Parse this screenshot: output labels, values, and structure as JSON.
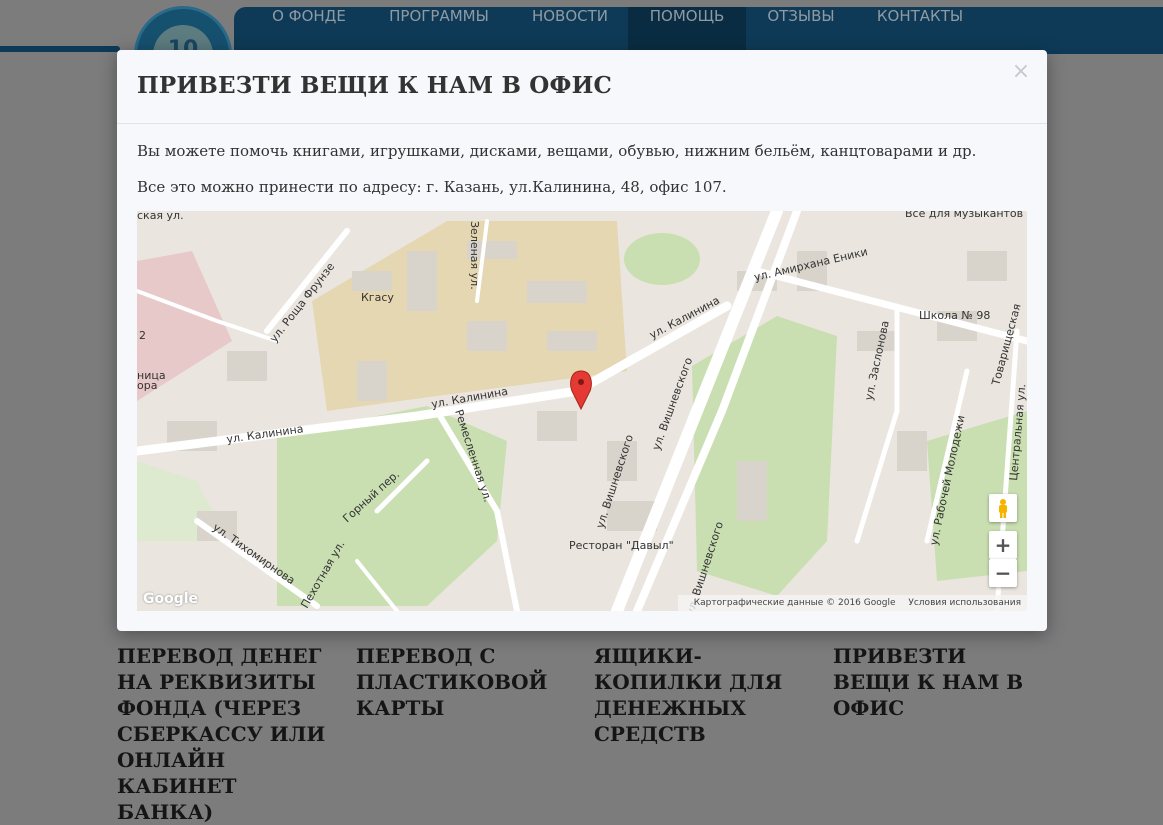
{
  "header": {
    "logo_number": "10",
    "nav": [
      {
        "label": "О ФОНДЕ",
        "active": false
      },
      {
        "label": "ПРОГРАММЫ",
        "active": false
      },
      {
        "label": "НОВОСТИ",
        "active": false
      },
      {
        "label": "ПОМОЩЬ",
        "active": true
      },
      {
        "label": "ОТЗЫВЫ",
        "active": false
      },
      {
        "label": "КОНТАКТЫ",
        "active": false
      }
    ]
  },
  "cards": [
    {
      "title": "ПЕРЕВОД ДЕНЕГ НА РЕКВИЗИТЫ ФОНДА (ЧЕРЕЗ СБЕРКАССУ ИЛИ ОНЛАЙН КАБИНЕТ БАНКА)"
    },
    {
      "title": "ПЕРЕВОД С ПЛАСТИКОВОЙ КАРТЫ"
    },
    {
      "title": "ЯЩИКИ-КОПИЛКИ ДЛЯ ДЕНЕЖНЫХ СРЕДСТВ"
    },
    {
      "title": "ПРИВЕЗТИ ВЕЩИ К НАМ В ОФИС"
    }
  ],
  "modal": {
    "title": "ПРИВЕЗТИ ВЕЩИ К НАМ В ОФИС",
    "close_label": "×",
    "text1": "Вы можете помочь книгами, игрушками, дисками, вещами, обувью, нижним бельём, канцтоварами и др.",
    "text2": "Все это можно принести по адресу: г. Казань, ул.Калинина, 48, офис 107."
  },
  "map": {
    "labels": {
      "kalinina_1": "ул. Калинина",
      "kalinina_2": "ул. Калинина",
      "kalinina_3": "ул. Калинина",
      "roscha": "ул. Роща Фрунзе",
      "amirhana": "ул. Амирхана Еники",
      "vishnevskogo_1": "ул. Вишневского",
      "vishnevskogo_2": "ул. Вишневского",
      "vishnevskogo_3": "ул. Вишневского",
      "remeslennaya": "Ремесленная ул.",
      "gorny": "Горный пер.",
      "tihomirnova": "ул. Тихомирнова",
      "zaslonova": "ул. Заслонова",
      "rabochey": "ул. Рабочей Молодежи",
      "tsentralnaya": "Центральная ул.",
      "tovarisch": "Товарищеская",
      "pehotnaya": "Пехотная ул.",
      "zelenaya": "Зеленая ул.",
      "kgasu": "Кгасу",
      "school": "Школа № 98",
      "restaurant": "Ресторан \"Давыл\"",
      "music": "Все для музыкантов",
      "hosp_1": "2",
      "hosp_2": "ница",
      "hosp_3": "ора",
      "top_left": "ская ул."
    },
    "zoom_in": "+",
    "zoom_out": "−",
    "logo": "Google",
    "footer_data": "Картографические данные © 2016 Google",
    "footer_terms": "Условия использования"
  }
}
